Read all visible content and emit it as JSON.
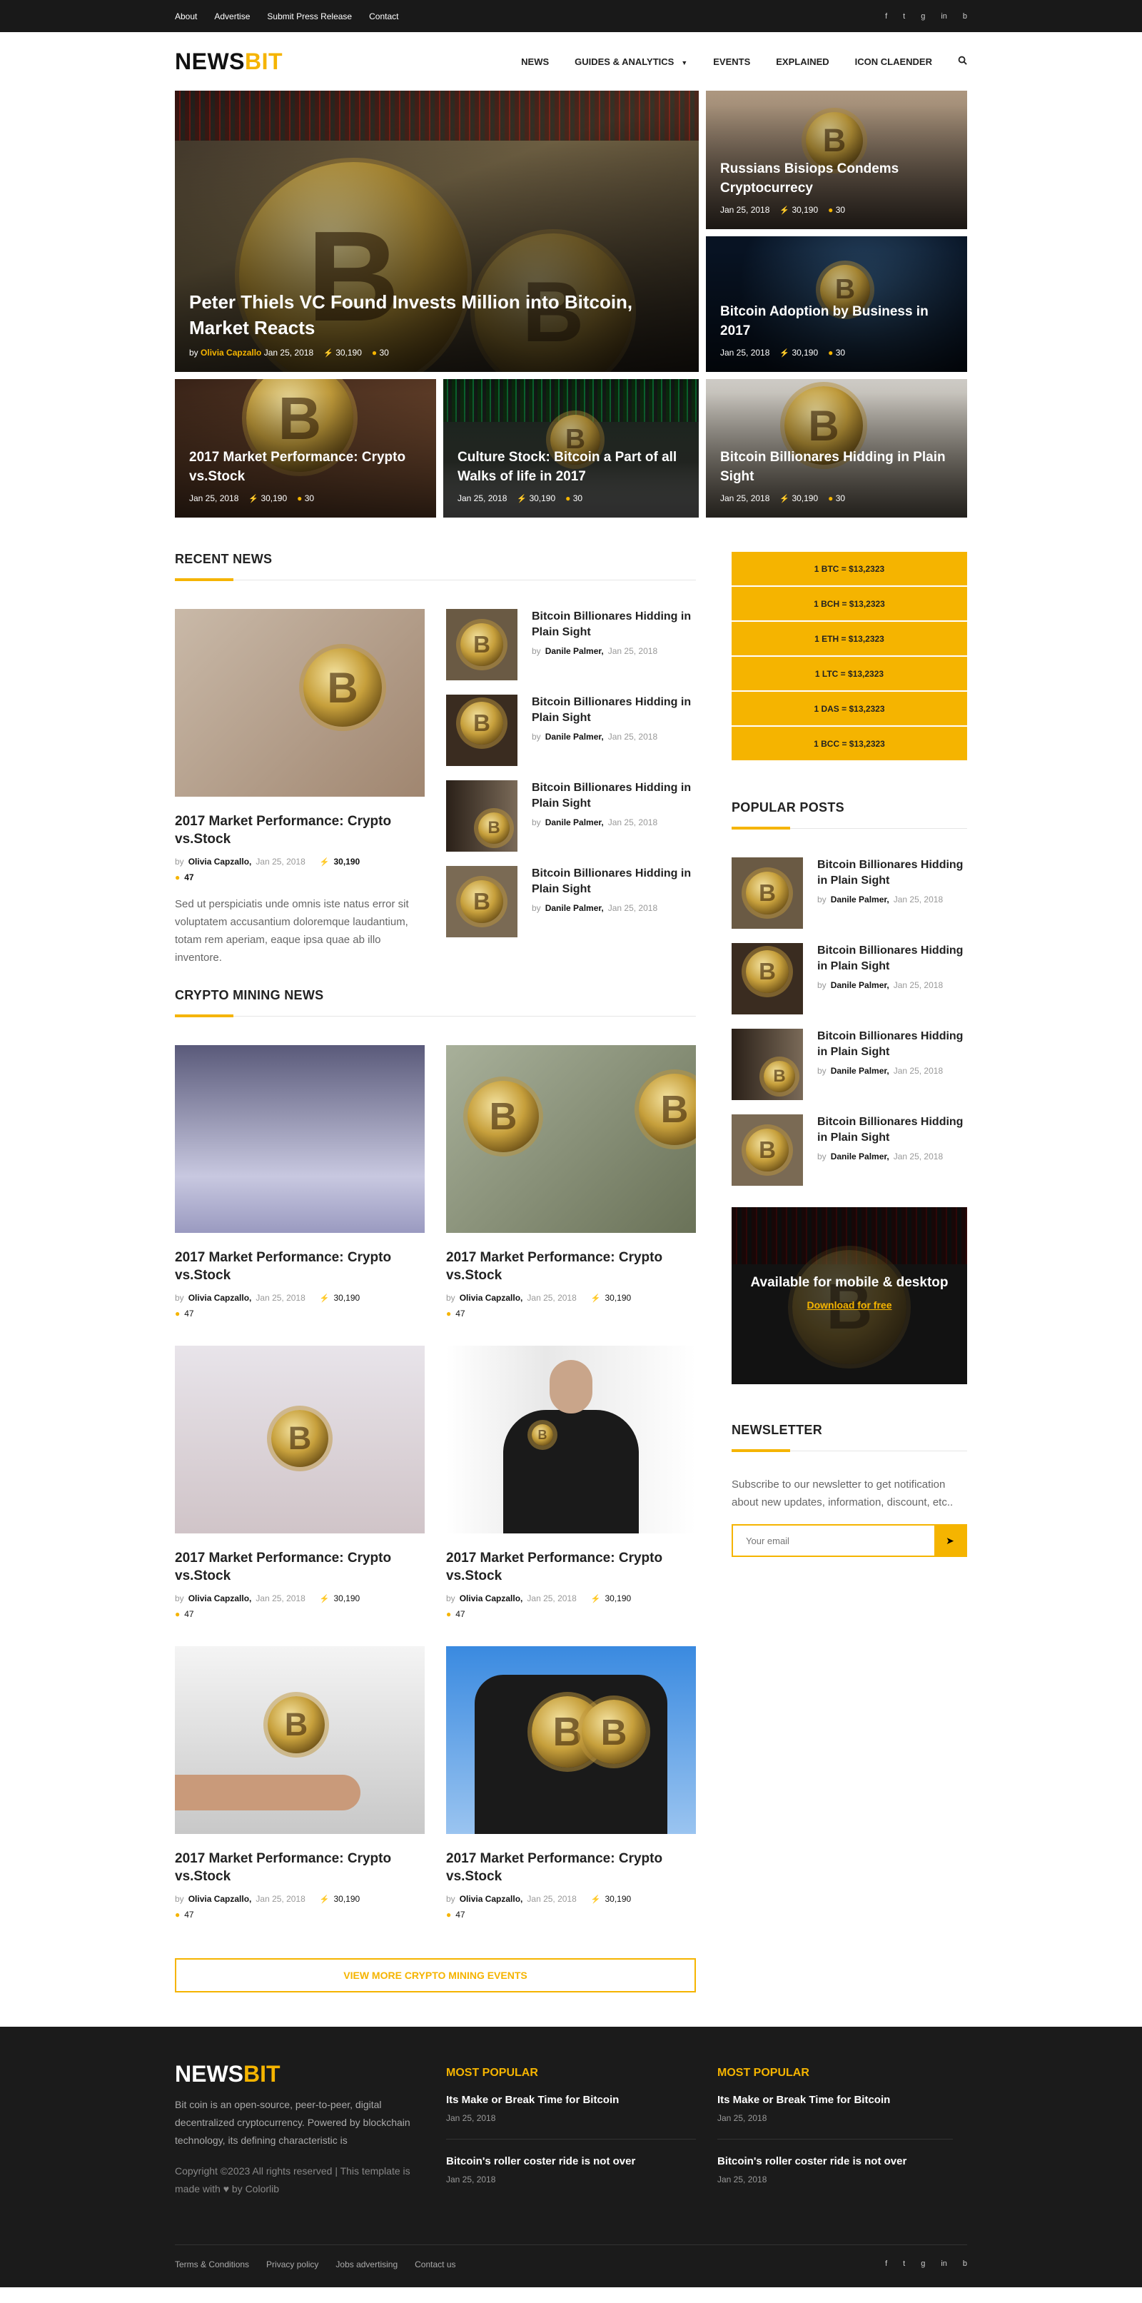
{
  "topbar": {
    "links": [
      "About",
      "Advertise",
      "Submit Press Release",
      "Contact"
    ],
    "socials": [
      "f",
      "t",
      "g",
      "in",
      "b"
    ]
  },
  "header": {
    "logo_a": "NEWS",
    "logo_b": "BIT",
    "nav": [
      "NEWS",
      "GUIDES & ANALYTICS",
      "EVENTS",
      "EXPLAINED",
      "ICON CLAENDER"
    ]
  },
  "hero": {
    "big": {
      "title": "Peter Thiels VC Found Invests Million into Bitcoin, Market Reacts",
      "by": "by",
      "author": "Olivia Capzallo",
      "date": "Jan 25, 2018",
      "views": "30,190",
      "comments": "30"
    },
    "right": [
      {
        "title": "Russians Bisiops Condems Cryptocurrecy",
        "date": "Jan 25, 2018",
        "views": "30,190",
        "comments": "30"
      },
      {
        "title": "Bitcoin Adoption by Business in 2017",
        "date": "Jan 25, 2018",
        "views": "30,190",
        "comments": "30"
      }
    ],
    "row": [
      {
        "title": "2017 Market Performance: Crypto vs.Stock",
        "date": "Jan 25, 2018",
        "views": "30,190",
        "comments": "30"
      },
      {
        "title": "Culture Stock: Bitcoin a Part of all Walks of life in 2017",
        "date": "Jan 25, 2018",
        "views": "30,190",
        "comments": "30"
      },
      {
        "title": "Bitcoin Billionares Hidding in Plain Sight",
        "date": "Jan 25, 2018",
        "views": "30,190",
        "comments": "30"
      }
    ]
  },
  "recent": {
    "title": "RECENT NEWS",
    "main": {
      "title": "2017 Market Performance: Crypto vs.Stock",
      "by": "by",
      "author": "Olivia Capzallo,",
      "date": "Jan 25, 2018",
      "views": "30,190",
      "comments": "47",
      "excerpt": "Sed ut perspiciatis unde omnis iste natus error sit voluptatem accusantium doloremque laudantium, totam rem aperiam, eaque ipsa quae ab illo inventore."
    },
    "list": [
      {
        "title": "Bitcoin Billionares Hidding in Plain Sight",
        "by": "by",
        "author": "Danile Palmer,",
        "date": "Jan 25, 2018"
      },
      {
        "title": "Bitcoin Billionares Hidding in Plain Sight",
        "by": "by",
        "author": "Danile Palmer,",
        "date": "Jan 25, 2018"
      },
      {
        "title": "Bitcoin Billionares Hidding in Plain Sight",
        "by": "by",
        "author": "Danile Palmer,",
        "date": "Jan 25, 2018"
      },
      {
        "title": "Bitcoin Billionares Hidding in Plain Sight",
        "by": "by",
        "author": "Danile Palmer,",
        "date": "Jan 25, 2018"
      }
    ]
  },
  "ticker": [
    "1 BTC = $13,2323",
    "1 BCH = $13,2323",
    "1 ETH = $13,2323",
    "1 LTC = $13,2323",
    "1 DAS = $13,2323",
    "1 BCC = $13,2323"
  ],
  "popular": {
    "title": "POPULAR POSTS",
    "list": [
      {
        "title": "Bitcoin Billionares Hidding in Plain Sight",
        "by": "by",
        "author": "Danile Palmer,",
        "date": "Jan 25, 2018"
      },
      {
        "title": "Bitcoin Billionares Hidding in Plain Sight",
        "by": "by",
        "author": "Danile Palmer,",
        "date": "Jan 25, 2018"
      },
      {
        "title": "Bitcoin Billionares Hidding in Plain Sight",
        "by": "by",
        "author": "Danile Palmer,",
        "date": "Jan 25, 2018"
      },
      {
        "title": "Bitcoin Billionares Hidding in Plain Sight",
        "by": "by",
        "author": "Danile Palmer,",
        "date": "Jan 25, 2018"
      }
    ]
  },
  "mining": {
    "title": "CRYPTO MINING NEWS",
    "cards": [
      {
        "title": "2017 Market Performance: Crypto vs.Stock",
        "by": "by",
        "author": "Olivia Capzallo,",
        "date": "Jan 25, 2018",
        "views": "30,190",
        "comments": "47"
      },
      {
        "title": "2017 Market Performance: Crypto vs.Stock",
        "by": "by",
        "author": "Olivia Capzallo,",
        "date": "Jan 25, 2018",
        "views": "30,190",
        "comments": "47"
      },
      {
        "title": "2017 Market Performance: Crypto vs.Stock",
        "by": "by",
        "author": "Olivia Capzallo,",
        "date": "Jan 25, 2018",
        "views": "30,190",
        "comments": "47"
      },
      {
        "title": "2017 Market Performance: Crypto vs.Stock",
        "by": "by",
        "author": "Olivia Capzallo,",
        "date": "Jan 25, 2018",
        "views": "30,190",
        "comments": "47"
      },
      {
        "title": "2017 Market Performance: Crypto vs.Stock",
        "by": "by",
        "author": "Olivia Capzallo,",
        "date": "Jan 25, 2018",
        "views": "30,190",
        "comments": "47"
      },
      {
        "title": "2017 Market Performance: Crypto vs.Stock",
        "by": "by",
        "author": "Olivia Capzallo,",
        "date": "Jan 25, 2018",
        "views": "30,190",
        "comments": "47"
      }
    ],
    "more": "VIEW MORE CRYPTO MINING EVENTS"
  },
  "promo": {
    "title": "Available for mobile & desktop",
    "link": "Download for free"
  },
  "newsletter": {
    "title": "NEWSLETTER",
    "text": "Subscribe to our newsletter to get notification about new updates, information, discount, etc..",
    "placeholder": "Your email"
  },
  "footer": {
    "logo_a": "NEWS",
    "logo_b": "BIT",
    "about": "Bit coin is an open-source, peer-to-peer, digital decentralized cryptocurrency. Powered by blockchain technology, its defining characteristic is",
    "copyright": "Copyright ©2023 All rights reserved | This template is made with ♥ by Colorlib",
    "col1": {
      "title": "MOST POPULAR",
      "items": [
        {
          "title": "Its Make or Break Time for Bitcoin",
          "date": "Jan 25, 2018"
        },
        {
          "title": "Bitcoin's roller coster ride is not over",
          "date": "Jan 25, 2018"
        }
      ]
    },
    "col2": {
      "title": "MOST POPULAR",
      "items": [
        {
          "title": "Its Make or Break Time for Bitcoin",
          "date": "Jan 25, 2018"
        },
        {
          "title": "Bitcoin's roller coster ride is not over",
          "date": "Jan 25, 2018"
        }
      ]
    },
    "links": [
      "Terms & Conditions",
      "Privacy policy",
      "Jobs advertising",
      "Contact us"
    ]
  },
  "colors": {
    "accent": "#f5b400",
    "dark": "#191919"
  }
}
